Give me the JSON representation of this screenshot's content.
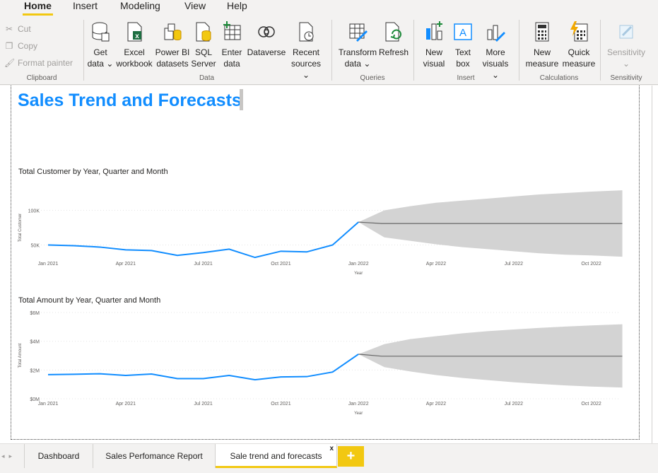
{
  "menu": {
    "tabs": [
      "Home",
      "Insert",
      "Modeling",
      "View",
      "Help"
    ],
    "active": "Home"
  },
  "ribbon": {
    "clipboard": {
      "label": "Clipboard",
      "cut": "Cut",
      "copy": "Copy",
      "format_painter": "Format painter"
    },
    "data": {
      "label": "Data",
      "get_data": [
        "Get",
        "data ⌄"
      ],
      "excel": [
        "Excel",
        "workbook"
      ],
      "pbi_datasets": [
        "Power BI",
        "datasets"
      ],
      "sql": [
        "SQL",
        "Server"
      ],
      "enter_data": [
        "Enter",
        "data"
      ],
      "dataverse": [
        "Dataverse",
        ""
      ],
      "recent": [
        "Recent",
        "sources ⌄"
      ]
    },
    "queries": {
      "label": "Queries",
      "transform": [
        "Transform",
        "data ⌄"
      ],
      "refresh": [
        "Refresh",
        ""
      ]
    },
    "insert": {
      "label": "Insert",
      "new_visual": [
        "New",
        "visual"
      ],
      "text_box": [
        "Text",
        "box"
      ],
      "more_visuals": [
        "More",
        "visuals ⌄"
      ]
    },
    "calculations": {
      "label": "Calculations",
      "new_measure": [
        "New",
        "measure"
      ],
      "quick_measure": [
        "Quick",
        "measure"
      ]
    },
    "sensitivity": {
      "label": "Sensitivity",
      "button": [
        "Sensitivity",
        "⌄"
      ]
    }
  },
  "report": {
    "title": "Sales Trend and Forecasts"
  },
  "chart_data": [
    {
      "type": "line",
      "title": "Total Customer by Year, Quarter and Month",
      "xlabel": "Year",
      "ylabel": "Total Customer",
      "x_ticks": [
        "Jan 2021",
        "Apr 2021",
        "Jul 2021",
        "Oct 2021",
        "Jan 2022",
        "Apr 2022",
        "Jul 2022",
        "Oct 2022"
      ],
      "y_ticks": [
        "50K",
        "100K"
      ],
      "ylim": [
        25000,
        125000
      ],
      "series": [
        {
          "values": [
            50000,
            49000,
            47000,
            43000,
            42000,
            35000,
            39000,
            44000,
            32000,
            41000,
            40000,
            50000,
            83000
          ]
        }
      ],
      "forecast": {
        "start": "Jan 2022",
        "end": "Nov 2022",
        "value": 81000,
        "upper": [
          83000,
          100000,
          106000,
          111000,
          114000,
          117000,
          120000,
          123000,
          125000,
          127000,
          129000
        ],
        "lower": [
          83000,
          61000,
          56000,
          51000,
          47000,
          44000,
          41000,
          38000,
          36000,
          35000,
          33000
        ]
      }
    },
    {
      "type": "line",
      "title": "Total Amount by Year, Quarter and Month",
      "xlabel": "Year",
      "ylabel": "Total Amount",
      "x_ticks": [
        "Jan 2021",
        "Apr 2021",
        "Jul 2021",
        "Oct 2021",
        "Jan 2022",
        "Apr 2022",
        "Jul 2022",
        "Oct 2022"
      ],
      "y_ticks": [
        "$0M",
        "$2M",
        "$4M",
        "$6M"
      ],
      "ylim": [
        0,
        6000000
      ],
      "series": [
        {
          "values": [
            1680000,
            1700000,
            1740000,
            1620000,
            1720000,
            1400000,
            1400000,
            1620000,
            1320000,
            1520000,
            1540000,
            1860000,
            3100000
          ]
        }
      ],
      "forecast": {
        "start": "Jan 2022",
        "end": "Nov 2022",
        "value": 2960000,
        "upper": [
          3100000,
          3800000,
          4150000,
          4350000,
          4550000,
          4700000,
          4820000,
          4930000,
          5020000,
          5100000,
          5180000
        ],
        "lower": [
          3100000,
          2200000,
          1900000,
          1650000,
          1450000,
          1300000,
          1150000,
          1030000,
          930000,
          850000,
          780000
        ]
      }
    }
  ],
  "page_tabs": {
    "tabs": [
      "Dashboard",
      "Sales Perfomance Report",
      "Sale trend and forecasts"
    ],
    "active_index": 2,
    "close": "x",
    "add": "+"
  },
  "colors": {
    "accent": "#118dff",
    "brand": "#f2c811",
    "forecast_band": "#d3d3d3",
    "forecast_line": "#666666"
  }
}
